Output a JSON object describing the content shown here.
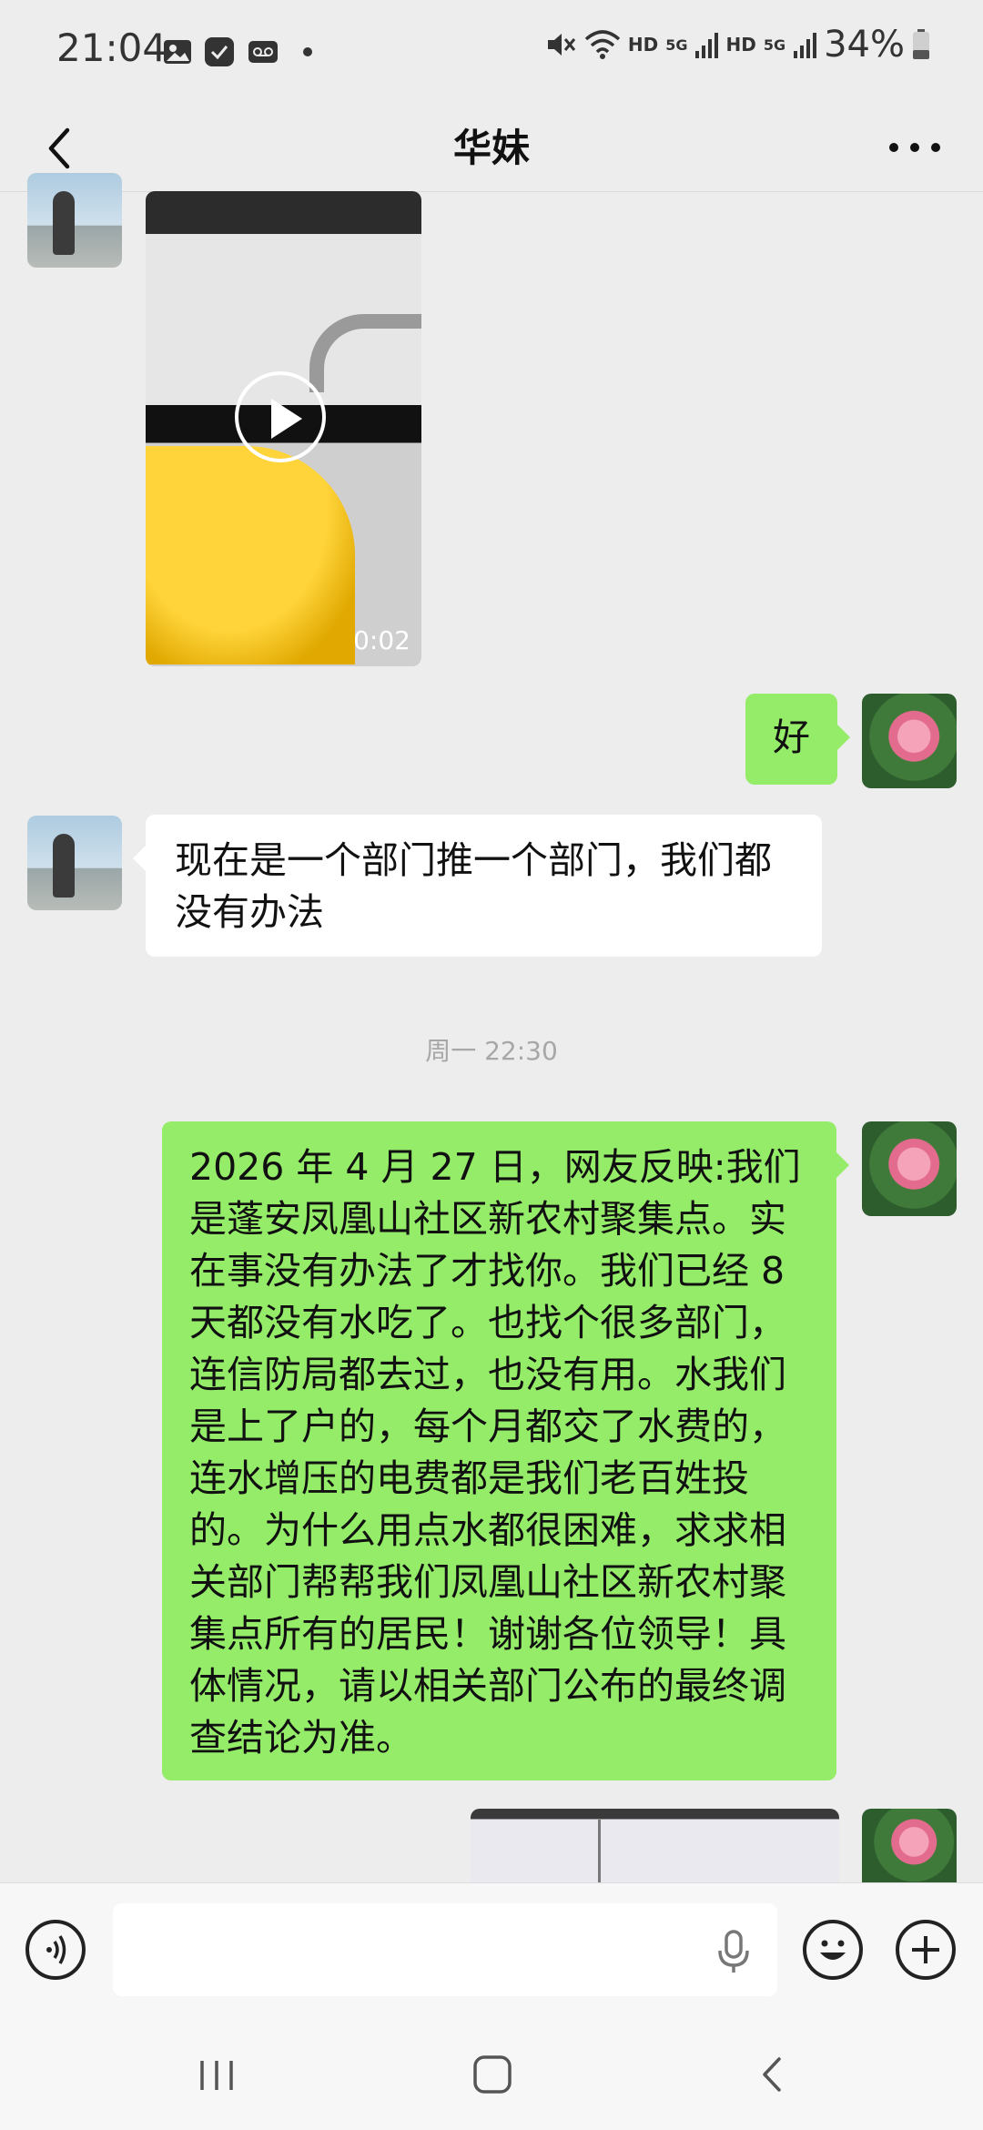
{
  "status_bar": {
    "time": "21:04",
    "hd1": "HD",
    "net1": "5G",
    "hd2": "HD",
    "net2": "5G",
    "battery": "34%",
    "icons": [
      "gallery-icon",
      "checkmark-app-icon",
      "voicemail-icon",
      "dot-icon",
      "mute-icon",
      "wifi-icon",
      "signal-icon",
      "signal-icon",
      "battery-icon"
    ]
  },
  "header": {
    "title": "华妹"
  },
  "messages": [
    {
      "side": "left",
      "type": "video",
      "duration": "0:02"
    },
    {
      "side": "right",
      "type": "text",
      "text": "好"
    },
    {
      "side": "left",
      "type": "text",
      "text": "现在是一个部门推一个部门，我们都没有办法"
    },
    {
      "type": "timestamp",
      "text": "周一 22:30"
    },
    {
      "side": "right",
      "type": "text",
      "text": "2026 年 4 月 27 日，网友反映:我们是蓬安凤凰山社区新农村聚集点。实在事没有办法了才找你。我们已经 8 天都没有水吃了。也找个很多部门，连信防局都去过，也没有用。水我们是上了户的，每个月都交了水费的，连水增压的电费都是我们老百姓投的。为什么用点水都很困难，求求相关部门帮帮我们凤凰山社区新农村聚集点所有的居民！谢谢各位领导！具体情况，请以相关部门公布的最终调查结论为准。"
    },
    {
      "side": "right",
      "type": "image"
    }
  ],
  "input": {
    "text": "",
    "icons": [
      "voice-icon",
      "microphone-icon",
      "emoji-icon",
      "plus-icon"
    ]
  },
  "nav": {
    "icons": [
      "recent-apps-icon",
      "home-icon",
      "back-icon"
    ]
  },
  "colors": {
    "background": "#ededed",
    "bubble_green": "#95ec69",
    "bubble_white": "#ffffff"
  }
}
